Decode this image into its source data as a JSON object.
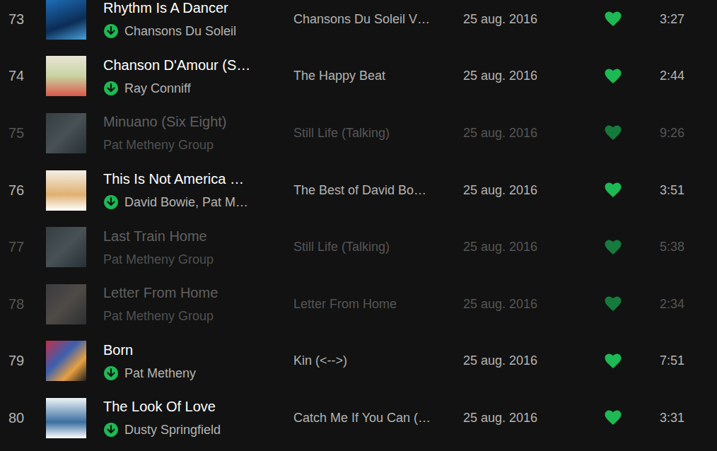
{
  "tracks": [
    {
      "number": "73",
      "title": "Rhythm Is A Dancer",
      "artist": "Chansons Du Soleil",
      "album": "Chansons Du Soleil V…",
      "date_added": "25 aug. 2016",
      "liked": true,
      "duration": "3:27",
      "available": true,
      "downloaded": true
    },
    {
      "number": "74",
      "title": "Chanson D'Amour (S…",
      "artist": "Ray Conniff",
      "album": "The Happy Beat",
      "date_added": "25 aug. 2016",
      "liked": true,
      "duration": "2:44",
      "available": true,
      "downloaded": true
    },
    {
      "number": "75",
      "title": "Minuano (Six Eight)",
      "artist": "Pat Metheny Group",
      "album": "Still Life (Talking)",
      "date_added": "25 aug. 2016",
      "liked": true,
      "duration": "9:26",
      "available": false,
      "downloaded": false
    },
    {
      "number": "76",
      "title": "This Is Not America …",
      "artist": "David Bowie, Pat M…",
      "album": "The Best of David Bo…",
      "date_added": "25 aug. 2016",
      "liked": true,
      "duration": "3:51",
      "available": true,
      "downloaded": true
    },
    {
      "number": "77",
      "title": "Last Train Home",
      "artist": "Pat Metheny Group",
      "album": "Still Life (Talking)",
      "date_added": "25 aug. 2016",
      "liked": true,
      "duration": "5:38",
      "available": false,
      "downloaded": false
    },
    {
      "number": "78",
      "title": "Letter From Home",
      "artist": "Pat Metheny Group",
      "album": "Letter From Home",
      "date_added": "25 aug. 2016",
      "liked": true,
      "duration": "2:34",
      "available": false,
      "downloaded": false
    },
    {
      "number": "79",
      "title": "Born",
      "artist": "Pat Metheny",
      "album": "Kin (<-->)",
      "date_added": "25 aug. 2016",
      "liked": true,
      "duration": "7:51",
      "available": true,
      "downloaded": true
    },
    {
      "number": "80",
      "title": "The Look Of Love",
      "artist": "Dusty Springfield",
      "album": "Catch Me If You Can (…",
      "date_added": "25 aug. 2016",
      "liked": true,
      "duration": "3:31",
      "available": true,
      "downloaded": true
    }
  ]
}
